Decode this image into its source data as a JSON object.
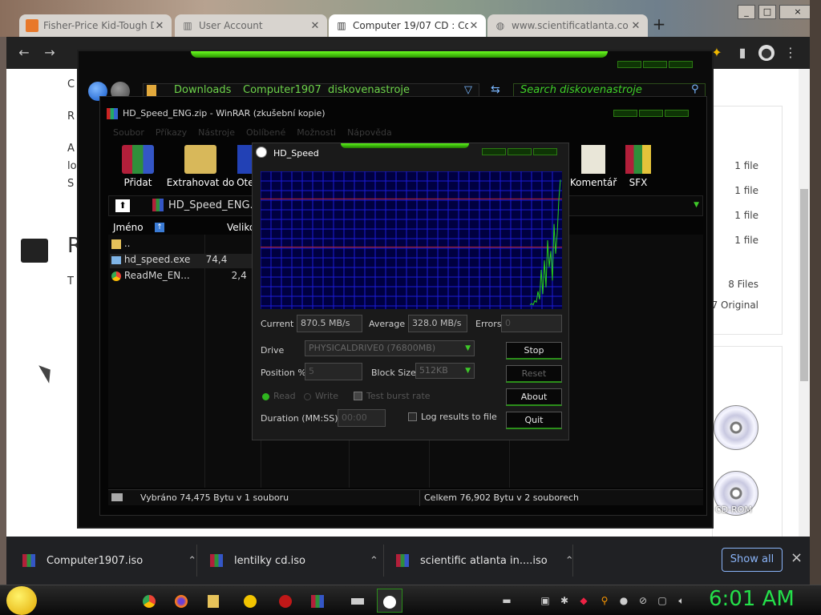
{
  "browser": {
    "tabs": [
      {
        "title": "Fisher-Price Kid-Tough D",
        "active": false
      },
      {
        "title": "User Account",
        "active": false
      },
      {
        "title": "Computer 19/07 CD : Co",
        "active": true
      },
      {
        "title": "www.scientificatlanta.co",
        "active": false
      }
    ],
    "new_tab": "+",
    "window_controls": [
      "_",
      "□",
      "×"
    ],
    "toolbar_icons": [
      "back-arrow",
      "forward-arrow",
      "extension",
      "sidebar",
      "profile",
      "menu"
    ],
    "page": {
      "partial_letters": [
        "C",
        "R",
        "A",
        "lo",
        "S",
        "R",
        "T"
      ],
      "side_list": [
        "1 file",
        "1 file",
        "1 file",
        "1 file",
        "8 Files",
        "7 Original"
      ],
      "disc_labels": [
        "CD-ROM"
      ]
    }
  },
  "explorer": {
    "breadcrumb": [
      "Downloads",
      "Computer1907",
      "diskovenastroje"
    ],
    "search_placeholder": "Search diskovenastroje"
  },
  "winrar": {
    "title": "HD_Speed_ENG.zip - WinRAR (zkušební kopie)",
    "menu": [
      "Soubor",
      "Příkazy",
      "Nástroje",
      "Oblíbené",
      "Možnosti",
      "Nápověda"
    ],
    "toolbar": [
      {
        "label": "Přidat"
      },
      {
        "label": "Extrahovat do"
      },
      {
        "label": "Otes"
      },
      {
        "label": "Komentář"
      },
      {
        "label": "SFX"
      }
    ],
    "path": "HD_Speed_ENG..",
    "columns": [
      "Jméno",
      "Veliko"
    ],
    "rows": [
      {
        "name": "..",
        "size": ""
      },
      {
        "name": "hd_speed.exe",
        "size": "74,4"
      },
      {
        "name": "ReadMe_EN...",
        "size": "2,4"
      }
    ],
    "status_left": "Vybráno 74,475 Bytu v 1 souboru",
    "status_right": "Celkem 76,902 Bytu v 2 souborech"
  },
  "hdspeed": {
    "title": "HD_Speed",
    "labels": {
      "current": "Current",
      "average": "Average",
      "errors": "Errors",
      "drive": "Drive",
      "position": "Position %",
      "block_size": "Block Size",
      "read": "Read",
      "write": "Write",
      "test_burst": "Test burst rate",
      "duration": "Duration (MM:SS)",
      "log": "Log results to file"
    },
    "values": {
      "current": "870.5 MB/s",
      "average": "328.0 MB/s",
      "errors": "0",
      "drive": "PHYSICALDRIVE0 (76800MB)",
      "position": "5",
      "block_size": "512KB",
      "duration": "00:00"
    },
    "buttons": {
      "stop": "Stop",
      "reset": "Reset",
      "about": "About",
      "quit": "Quit"
    },
    "graph": {
      "series": [
        0.02,
        0.03,
        0.02,
        0.05,
        0.04,
        0.12,
        0.06,
        0.28,
        0.1,
        0.35,
        0.15,
        0.5,
        0.3,
        0.42,
        0.2,
        0.62,
        0.4,
        0.55,
        0.8,
        0.95
      ],
      "upper_line_fraction": 0.8,
      "lower_line_fraction": 0.45,
      "colors": {
        "grid": "#1b1bd8",
        "bg": "#000040",
        "line": "#27d31b",
        "marker": "#c0272d"
      }
    }
  },
  "downloads": {
    "items": [
      "Computer1907.iso",
      "lentilky cd.iso",
      "scientific atlanta in....iso"
    ],
    "show_all": "Show all",
    "close": "×"
  },
  "taskbar": {
    "clock": "6:01 AM"
  },
  "colors": {
    "accent_green": "#3fd128",
    "clock_green": "#24e04a"
  }
}
